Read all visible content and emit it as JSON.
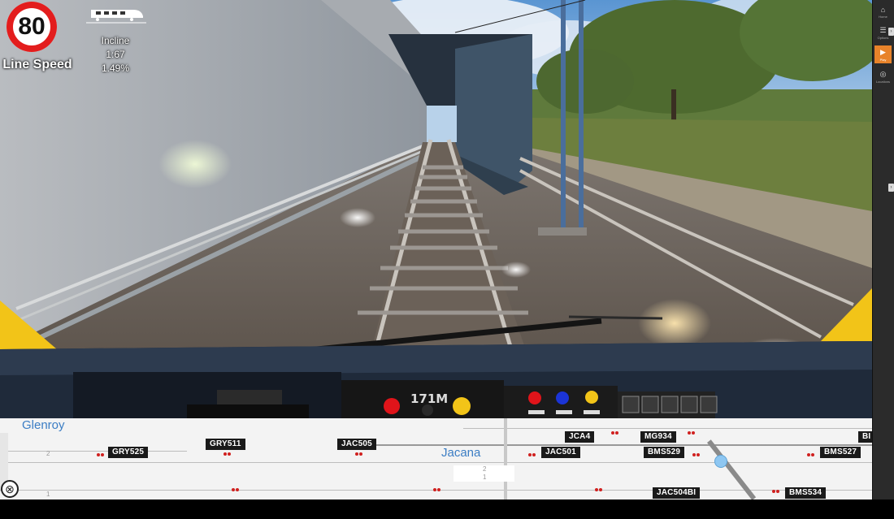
{
  "hud": {
    "speed_limit": "80",
    "speed_limit_label": "Line Speed",
    "incline_title": "Incline",
    "incline_ratio": "1:67",
    "incline_percent": "1.49%"
  },
  "cab": {
    "unit_number": "171M"
  },
  "sidebar": {
    "items": [
      {
        "icon": "home-icon",
        "label": "Home"
      },
      {
        "icon": "options-icon",
        "label": "Options"
      },
      {
        "icon": "play-icon",
        "label": "Play",
        "active": true
      },
      {
        "icon": "locations-icon",
        "label": "Locations"
      }
    ]
  },
  "track_map": {
    "stations": [
      {
        "name": "Glenroy"
      },
      {
        "name": "Jacana"
      }
    ],
    "signals": [
      {
        "id": "GRY525"
      },
      {
        "id": "GRY511"
      },
      {
        "id": "JAC505"
      },
      {
        "id": "JCA4"
      },
      {
        "id": "MG934"
      },
      {
        "id": "JAC501"
      },
      {
        "id": "BMS529"
      },
      {
        "id": "BMS527"
      },
      {
        "id": "BI"
      },
      {
        "id": "JAC504BI"
      },
      {
        "id": "BMS534"
      }
    ],
    "track_numbers": [
      "2",
      "1",
      "2",
      "1"
    ]
  },
  "colors": {
    "limit_ring": "#e31d1d",
    "station_text": "#3b7dc4",
    "signal_aspect": "#d0201f",
    "sidebar_active": "#e8832a",
    "cab_body": "#1f2a3a",
    "cab_accent": "#f2c418"
  }
}
